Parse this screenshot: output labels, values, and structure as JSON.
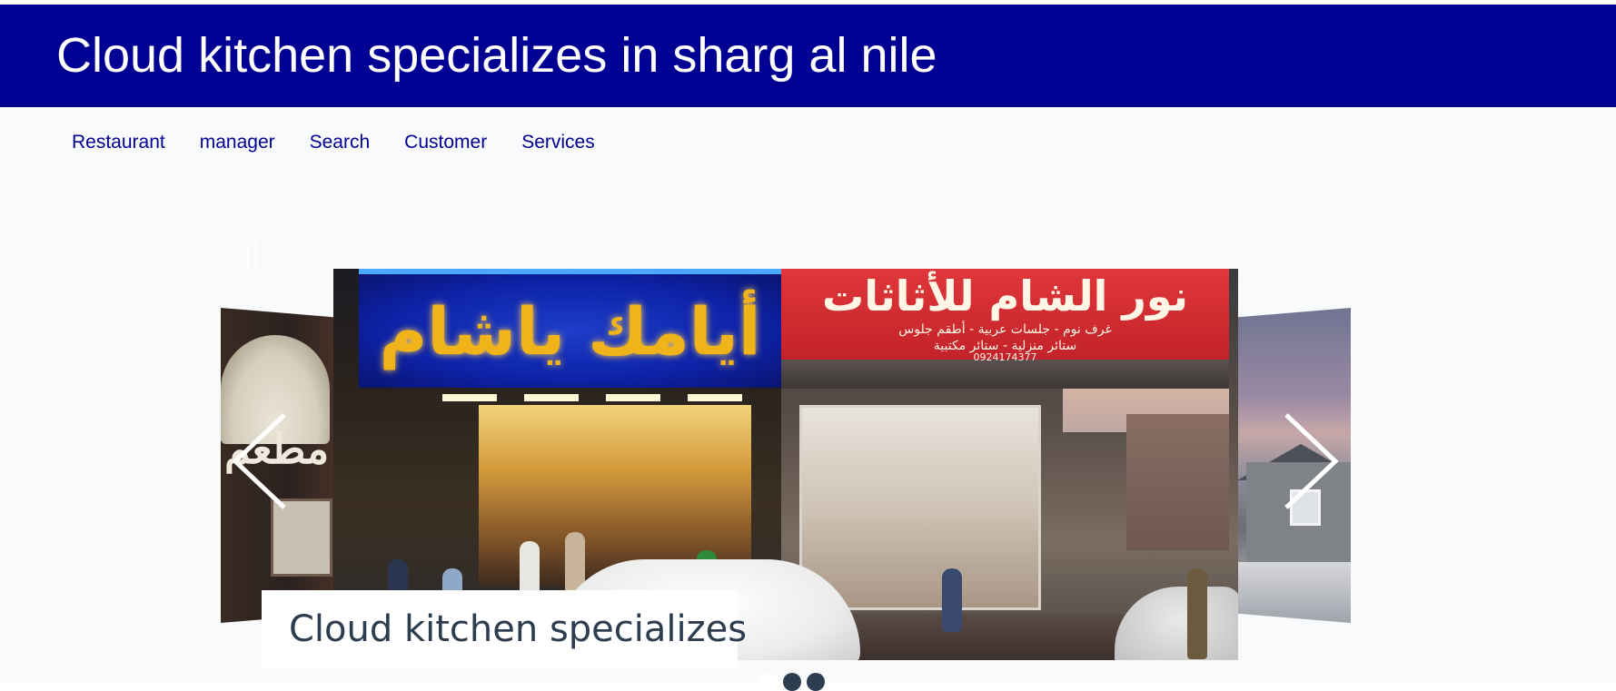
{
  "header": {
    "title": "Cloud kitchen specializes in sharg al nile"
  },
  "nav": {
    "items": [
      {
        "label": "Restaurant"
      },
      {
        "label": "manager"
      },
      {
        "label": "Search"
      },
      {
        "label": "Customer"
      },
      {
        "label": "Services"
      }
    ]
  },
  "carousel": {
    "pause_glyph": "||",
    "caption": "Cloud kitchen specializes",
    "main_slide": {
      "sign_left_text": "أيامك ياشام",
      "sign_right_text": "نور الشام للأثاثات",
      "sign_right_sub": "غرف نوم - جلسات عربية - أطقم جلوس",
      "sign_right_sub2": "ستائر منزلية - ستائر مكتبية",
      "sign_right_phone": "0924174377"
    },
    "side_left_text": "مطعم",
    "prev_icon": "chevron-left-icon",
    "next_icon": "chevron-right-icon",
    "dots_count": 3,
    "active_dot": 0
  },
  "colors": {
    "header_bg": "#000092",
    "nav_text": "#000092",
    "content_bg": "#f8fafc",
    "caption_text": "#2d3d50"
  }
}
